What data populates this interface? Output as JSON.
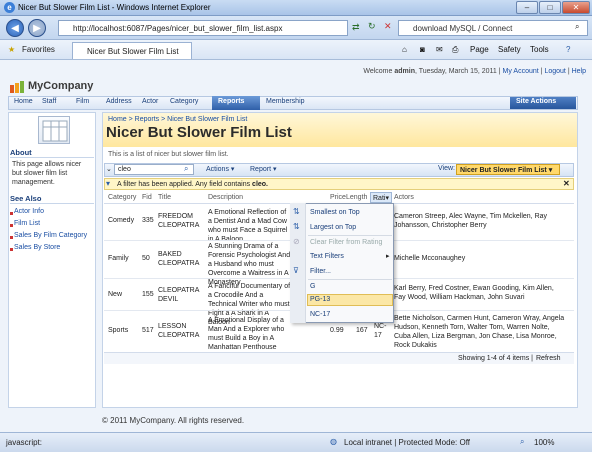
{
  "browser": {
    "window_title": "Nicer But Slower Film List - Windows Internet Explorer",
    "url": "http://localhost:6087/Pages/nicer_but_slower_film_list.aspx",
    "search_text": "download MySQL / Connect",
    "favorites_label": "Favorites",
    "tab_title": "Nicer But Slower Film List",
    "toolbar": {
      "page": "Page",
      "safety": "Safety",
      "tools": "Tools"
    },
    "status_left": "javascript:",
    "status_zone": "Local intranet | Protected Mode: Off",
    "zoom": "100%"
  },
  "header": {
    "welcome_prefix": "Welcome",
    "user": "admin",
    "date": ", Tuesday, March 15, 2011 |",
    "my_account": "My Account",
    "logout": "Logout",
    "help": "Help",
    "company": "MyCompany"
  },
  "menu": {
    "items": [
      "Home",
      "Staff",
      "Film",
      "Address",
      "Actor",
      "Category"
    ],
    "active": "Reports",
    "membership": "Membership",
    "site_actions": "Site Actions"
  },
  "sidebar": {
    "about_title": "About",
    "about_text": "This page allows nicer but slower film list management.",
    "see_also_title": "See Also",
    "links": [
      "Actor Info",
      "Film List",
      "Sales By Film Category",
      "Sales By Store"
    ]
  },
  "main": {
    "breadcrumb": "Home  >  Reports  >  Nicer But Slower Film List",
    "title": "Nicer But Slower Film List",
    "description": "This is a list of nicer but slower film list.",
    "quickfind": "cleo",
    "actions_label": "Actions",
    "report_label": "Report",
    "view_label": "View:",
    "view_value": "Nicer But Slower Film List",
    "filter_text_prefix": "A filter has been applied. Any field contains",
    "filter_value": "cleo."
  },
  "grid": {
    "columns": [
      "Category",
      "Fid",
      "Title",
      "Description",
      "Price",
      "Length",
      "Rati",
      "Actors"
    ],
    "rows": [
      {
        "category": "Comedy",
        "fid": "335",
        "title": "FREEDOM CLEOPATRA",
        "description": "A Emotional Reflection of a Dentist And a Mad Cow who must Face a Squirrel in A Baloon",
        "price": "",
        "length": "",
        "rating": "",
        "actors": "Cameron Streep, Alec Wayne, Tim Mckellen, Ray Johansson, Christopher Berry"
      },
      {
        "category": "Family",
        "fid": "50",
        "title": "BAKED CLEOPATRA",
        "description": "A Stunning Drama of a Forensic Psychologist And a Husband who must Overcome a Waitress in A Monastery",
        "price": "",
        "length": "",
        "rating": "",
        "actors": "Michelle Mcconaughey"
      },
      {
        "category": "New",
        "fid": "155",
        "title": "CLEOPATRA DEVIL",
        "description": "A Fanciful Documentary of a Crocodile And a Technical Writer who must Fight a A Shark in A Baloon",
        "price": "",
        "length": "",
        "rating": "",
        "actors": "Karl Berry, Fred Costner, Ewan Gooding, Kim Allen, Fay Wood, William Hackman, John Suvari"
      },
      {
        "category": "Sports",
        "fid": "517",
        "title": "LESSON CLEOPATRA",
        "description": "A Emotional Display of a Man And a Explorer who must Build a Boy in A Manhattan Penthouse",
        "price": "0.99",
        "length": "167",
        "rating": "NC-17",
        "actors": "Bette Nicholson, Carmen Hunt, Cameron Wray, Angela Hudson, Kenneth Torn, Walter Torn, Warren Nolte, Cuba Allen, Liza Bergman, Jon Chase, Lisa Monroe, Rock Dukakis"
      }
    ],
    "pager_text": "Showing 1-4 of 4 items |",
    "refresh": "Refresh"
  },
  "dropdown": {
    "items": [
      "Smallest on Top",
      "Largest on Top",
      "Clear Filter from Rating",
      "Text Filters",
      "Filter...",
      "G",
      "PG-13",
      "NC-17"
    ],
    "selected": "PG-13"
  },
  "footer": "© 2011 MyCompany. All rights reserved.",
  "colors": {
    "accent": "#2f5fa8",
    "title_band": "#ffe79e",
    "selected": "#fbe7a6"
  }
}
